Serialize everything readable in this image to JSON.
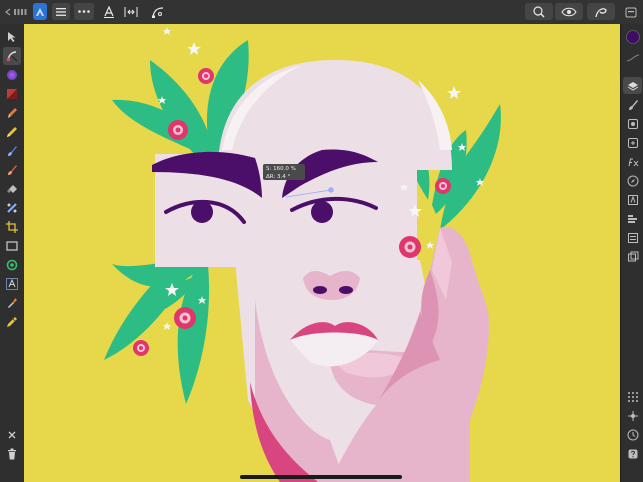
{
  "readout": {
    "saturation": "S: 160.0 %",
    "delta_r": "ΔR: 3.4 °"
  },
  "topbar": {
    "left": [
      "back-icon",
      "persona-icon",
      "menu-icon",
      "more-icon",
      "text-style-icon",
      "constraints-icon",
      "curve-icon"
    ],
    "right": [
      "snapping-icon",
      "view-mode-icon",
      "assist-icon",
      "export-icon"
    ]
  },
  "tools": [
    "move-icon",
    "node-icon",
    "color-picker-icon",
    "fill-icon",
    "pen-icon",
    "pencil-icon",
    "vector-brush-icon",
    "paint-brush-icon",
    "erase-icon",
    "shape-builder-icon",
    "crop-icon",
    "rectangle-icon",
    "ellipse-icon",
    "text-icon",
    "eyedropper-icon",
    "transparency-icon",
    "close-icon",
    "trash-icon"
  ],
  "right_panel": [
    "color-swatch",
    "stroke-icon",
    "layers-icon",
    "brushes-icon",
    "appearance-icon",
    "transform-icon",
    "fx-icon",
    "navigator-icon",
    "text-styles-icon",
    "align-icon",
    "character-icon",
    "stock-icon",
    "snapping-grid-icon",
    "transform-handles-icon",
    "history-icon",
    "help-icon"
  ],
  "colors": {
    "background": "#e6d84a",
    "eyebrow": "#4b0f6a",
    "skin_light": "#ece0e6",
    "skin_pink": "#e7b5cb",
    "lips": "#d9457f",
    "leaf": "#2dbd84",
    "flower": "#e0366b",
    "swatch": "#3d0d63"
  }
}
